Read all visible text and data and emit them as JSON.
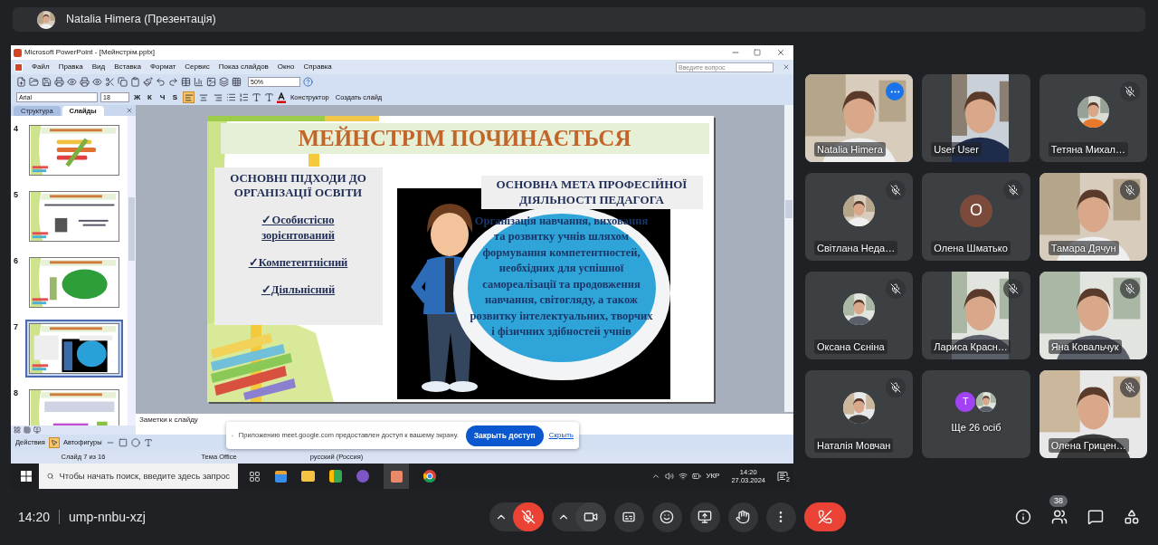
{
  "meeting_header": {
    "presenter": "Natalia Himera (Презентація)"
  },
  "powerpoint": {
    "title": "Microsoft PowerPoint - [Мейнстрім.pptx]",
    "menu": [
      "Файл",
      "Правка",
      "Вид",
      "Вставка",
      "Формат",
      "Сервис",
      "Показ слайдов",
      "Окно",
      "Справка"
    ],
    "help_placeholder": "Введите вопрос",
    "zoom": "50%",
    "font": "Arial",
    "font_size": "18",
    "text_style_buttons": [
      "Ж",
      "К",
      "Ч",
      "S"
    ],
    "alignment": [
      {
        "selected": true
      },
      {
        "selected": false
      },
      {
        "selected": false
      }
    ],
    "toolbar_commands": [
      "Конструктор",
      "Создать слайд"
    ],
    "pane_tabs": [
      {
        "label": "Структура",
        "selected": false
      },
      {
        "label": "Слайды",
        "selected": true
      }
    ],
    "slides": [
      {
        "number": "4",
        "selected": false
      },
      {
        "number": "5",
        "selected": false
      },
      {
        "number": "6",
        "selected": false
      },
      {
        "number": "7",
        "selected": true
      },
      {
        "number": "8",
        "selected": false
      }
    ],
    "slide": {
      "title": "МЕЙНСТРІМ ПОЧИНАЄТЬСЯ",
      "left_heading": "ОСНОВНІ ПІДХОДИ ДО ОРГАНІЗАЦІЇ ОСВІТИ",
      "approaches": [
        "✓Особистісно зорієнтований",
        "✓Компетентнісний",
        "✓Діяльнісний"
      ],
      "right_heading": "ОСНОВНА МЕТА ПРОФЕСІЙНОЇ ДІЯЛЬНОСТІ ПЕДАГОГА",
      "goal": "Організація навчання, виховання та розвитку учнів шляхом формування компетентностей, необхідних для успішної самореалізації та продовження навчання, світогляду, а також розвитку інтелектуальних, творчих і фізичних здібностей учнів"
    },
    "notes_placeholder": "Заметки к слайду",
    "drawing_toolbar": [
      "Действия",
      "Автофигуры"
    ],
    "status_bar": [
      "Слайд 7 из 16",
      "Тема Office",
      "русский (Россия)"
    ]
  },
  "taskbar": {
    "search_placeholder": "Чтобы начать поиск, введите здесь запрос",
    "language": "УКР",
    "time": "14:20",
    "date": "27.03.2024",
    "notifications": "2"
  },
  "share_notice": {
    "message": "Приложению meet.google.com предоставлен доступ к вашему экрану.",
    "stop_button": "Закрыть доступ",
    "hide_link": "Скрыть"
  },
  "participants": [
    {
      "name": "Natalia Himera",
      "kind": "video",
      "muted": false,
      "highlighted": true
    },
    {
      "name": "User User",
      "kind": "portrait_video",
      "muted": false,
      "highlighted": false
    },
    {
      "name": "Тетяна Михал…",
      "muted": true,
      "highlighted": false
    },
    {
      "name": "Світлана Неда…",
      "muted": true,
      "highlighted": false
    },
    {
      "name": "Олена Шматько",
      "kind": "initial",
      "initial": "О",
      "color": "#7b4a3a",
      "muted": true,
      "highlighted": false
    },
    {
      "name": "Тамара Дячун",
      "kind": "video",
      "muted": true,
      "highlighted": false
    },
    {
      "name": "Оксана Сєніна",
      "muted": true,
      "highlighted": false
    },
    {
      "name": "Лариса Красн…",
      "kind": "portrait_video",
      "muted": true,
      "highlighted": false
    },
    {
      "name": "Яна Ковальчук",
      "kind": "video",
      "muted": true,
      "highlighted": false
    },
    {
      "name": "Наталія Мовчан",
      "muted": true,
      "highlighted": false
    },
    {
      "name": "Ще 26 осіб",
      "kind": "others",
      "initial": "T",
      "color": "#a142f4",
      "muted": false,
      "highlighted": false
    },
    {
      "name": "Олена Грицен…",
      "kind": "video",
      "muted": true,
      "highlighted": false
    }
  ],
  "controls": {
    "time": "14:20",
    "meeting_code": "ump-nnbu-xzj",
    "mic_on": false,
    "participant_count": "38"
  }
}
